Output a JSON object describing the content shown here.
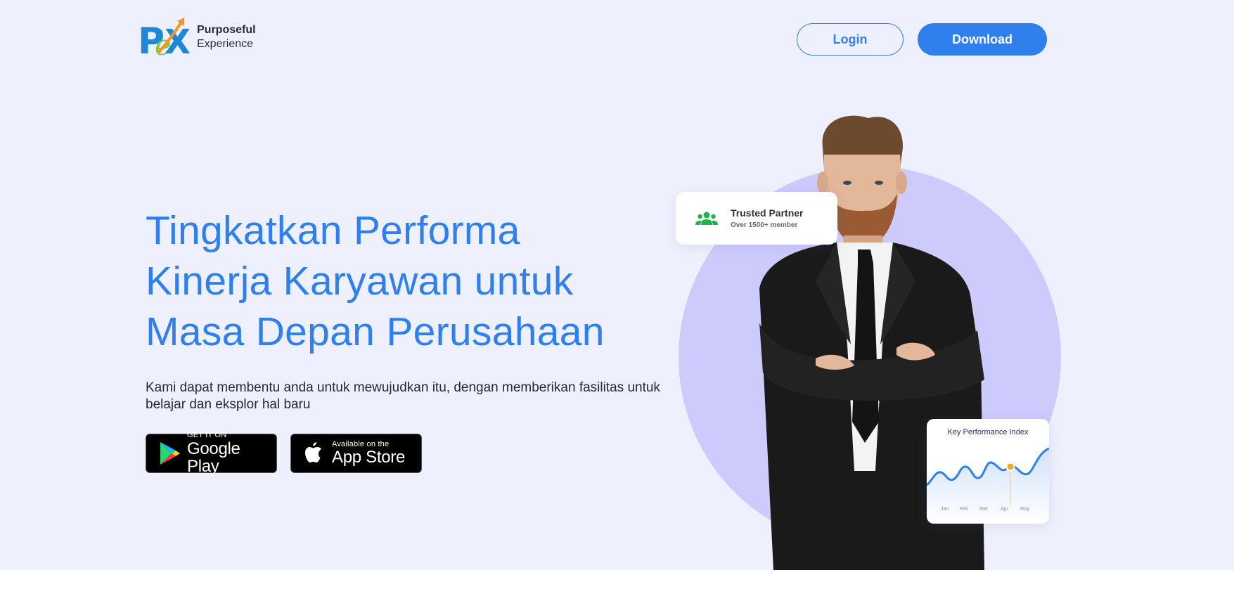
{
  "header": {
    "logo": {
      "mark_text": "PeX",
      "line1": "Purposeful",
      "line2": "Experience"
    },
    "login_label": "Login",
    "download_label": "Download"
  },
  "hero": {
    "headline_lines": [
      "Tingkatkan Performa",
      "Kinerja Karyawan untuk",
      "Masa Depan Perusahaan"
    ],
    "subtext": "Kami dapat membentu anda untuk mewujudkan itu, dengan memberikan fasilitas untuk belajar dan eksplor hal baru",
    "google_play": {
      "small": "GET IT ON",
      "big": "Google Play"
    },
    "app_store": {
      "small": "Available on the",
      "big": "App Store"
    }
  },
  "cards": {
    "trusted": {
      "title": "Trusted Partner",
      "subtitle": "Over 1500+ member",
      "icon": "users-icon"
    },
    "kpi": {
      "title": "Key Performance Index",
      "months": [
        "Jan",
        "Feb",
        "Mar",
        "Apr",
        "May"
      ],
      "highlight_month": "Apr"
    }
  },
  "colors": {
    "accent": "#2f80ed",
    "background": "#eef1fd",
    "circle": "#cdcbfc",
    "marker": "#f5a623",
    "trusted_icon": "#22b14c"
  }
}
